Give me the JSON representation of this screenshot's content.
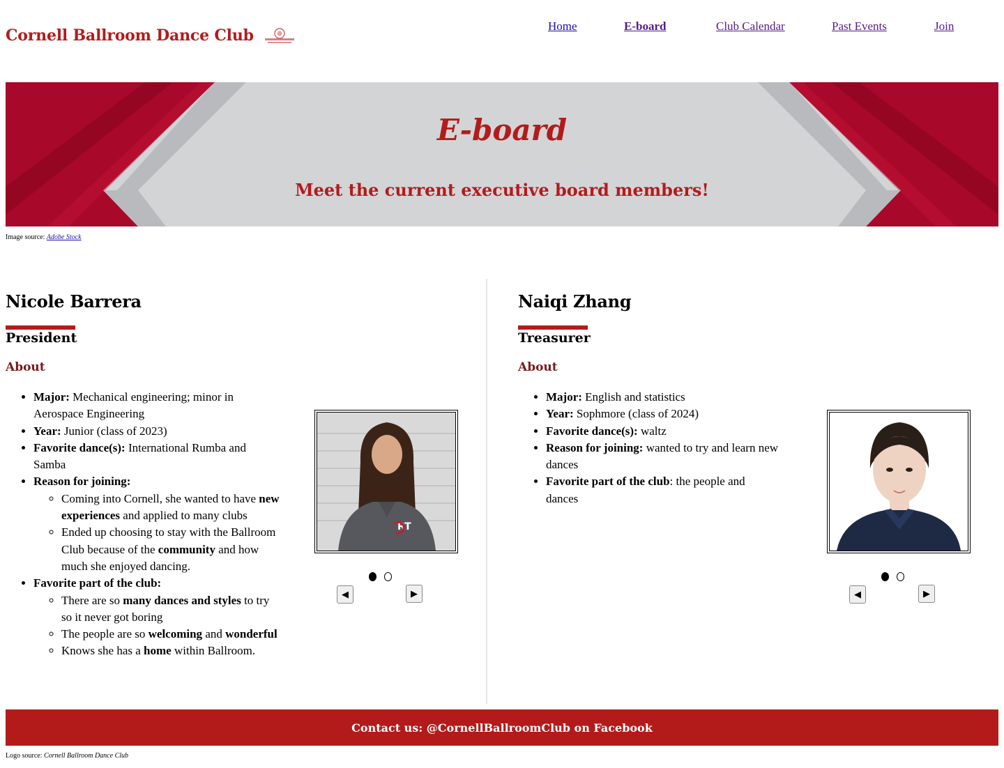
{
  "header": {
    "site_title": "Cornell Ballroom Dance Club",
    "logo_icon": "club-logo",
    "nav": [
      {
        "label": "Home"
      },
      {
        "label": "E-board"
      },
      {
        "label": "Club Calendar"
      },
      {
        "label": "Past Events"
      },
      {
        "label": "Join"
      }
    ]
  },
  "banner": {
    "title": "E-board",
    "subtitle": "Meet the current executive board members!",
    "image_source_prefix": "Image source: ",
    "image_source_link": "Adobe Stock"
  },
  "members": [
    {
      "name": "Nicole Barrera",
      "role": "President",
      "about_heading": "About",
      "major_label": "Major:",
      "major": " Mechanical engineering; minor in Aerospace Engineering",
      "year_label": "Year:",
      "year": " Junior (class of 2023)",
      "dance_label": "Favorite dance(s):",
      "dance": " International Rumba and Samba",
      "reason_label": "Reason for joining:",
      "reason_1a": "Coming into Cornell, she wanted to have ",
      "reason_1b": "new experiences",
      "reason_1c": " and applied to many clubs",
      "reason_2a": "Ended up choosing to stay with the Ballroom Club because of the ",
      "reason_2b": "community",
      "reason_2c": " and how much she enjoyed dancing.",
      "fav_label": "Favorite part of the club:",
      "fav_1a": "There are so ",
      "fav_1b": "many dances and styles",
      "fav_1c": " to try so it never got boring",
      "fav_2a": "The people are so ",
      "fav_2b": "welcoming",
      "fav_2c": " and ",
      "fav_2d": "wonderful",
      "fav_3a": "Knows she has a ",
      "fav_3b": "home",
      "fav_3c": " within Ballroom.",
      "prev_glyph": "◀",
      "next_glyph": "▶"
    },
    {
      "name": "Naiqi Zhang",
      "role": "Treasurer",
      "about_heading": "About",
      "major_label": "Major:",
      "major": " English and statistics",
      "year_label": "Year:",
      "year": " Sophmore (class of 2024)",
      "dance_label": "Favorite dance(s):",
      "dance": " waltz",
      "reason_label": "Reason for joining:",
      "reason": " wanted to try and learn new dances",
      "fav_label": "Favorite part of the club",
      "fav": ": the people and dances",
      "prev_glyph": "◀",
      "next_glyph": "▶"
    }
  ],
  "footer": {
    "contact": "Contact us: @CornellBallroomClub on Facebook",
    "logo_source_prefix": "Logo source: ",
    "logo_source": "Cornell Ballroom Dance Club"
  },
  "colors": {
    "brand_red": "#b31b1b",
    "about_heading": "#7a1a1a",
    "banner_gray": "#d3d4d6"
  }
}
